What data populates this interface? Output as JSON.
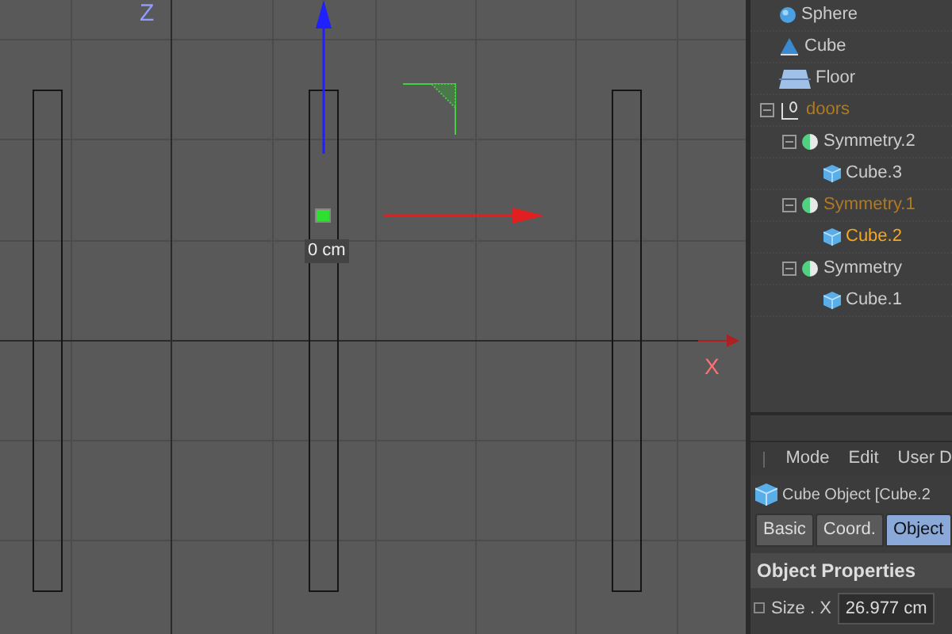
{
  "viewport": {
    "axis_labels": [
      {
        "kind": "z",
        "text": "Z"
      },
      {
        "kind": "x",
        "text": "X"
      }
    ],
    "measurement": "0 cm"
  },
  "object_tree": [
    {
      "name": "Sphere",
      "kind": "sphere",
      "selected": false,
      "highlighted": false
    },
    {
      "name": "Cube",
      "kind": "cone",
      "selected": false,
      "highlighted": false
    },
    {
      "name": "Floor",
      "kind": "floor",
      "selected": false,
      "highlighted": false
    },
    {
      "name": "doors",
      "kind": "null",
      "selected": false,
      "highlighted": true,
      "expanded": true,
      "children": [
        {
          "name": "Symmetry.2",
          "kind": "symmetry",
          "selected": false,
          "highlighted": false,
          "expanded": true,
          "children": [
            {
              "name": "Cube.3",
              "kind": "cube",
              "selected": false,
              "highlighted": false
            }
          ]
        },
        {
          "name": "Symmetry.1",
          "kind": "symmetry",
          "selected": false,
          "highlighted": true,
          "expanded": true,
          "children": [
            {
              "name": "Cube.2",
              "kind": "cube",
              "selected": true,
              "highlighted": false
            }
          ]
        },
        {
          "name": "Symmetry",
          "kind": "symmetry",
          "selected": false,
          "highlighted": false,
          "expanded": true,
          "children": [
            {
              "name": "Cube.1",
              "kind": "cube",
              "selected": false,
              "highlighted": false
            }
          ]
        }
      ]
    }
  ],
  "attributes": {
    "menu": [
      "Mode",
      "Edit",
      "User D"
    ],
    "title": "Cube Object [Cube.2",
    "tabs": [
      {
        "label": "Basic",
        "selected": false
      },
      {
        "label": "Coord.",
        "selected": false
      },
      {
        "label": "Object",
        "selected": true
      }
    ],
    "section": "Object Properties",
    "fields": [
      {
        "label": "Size . X",
        "value": "26.977 cm",
        "checked": false
      }
    ]
  }
}
